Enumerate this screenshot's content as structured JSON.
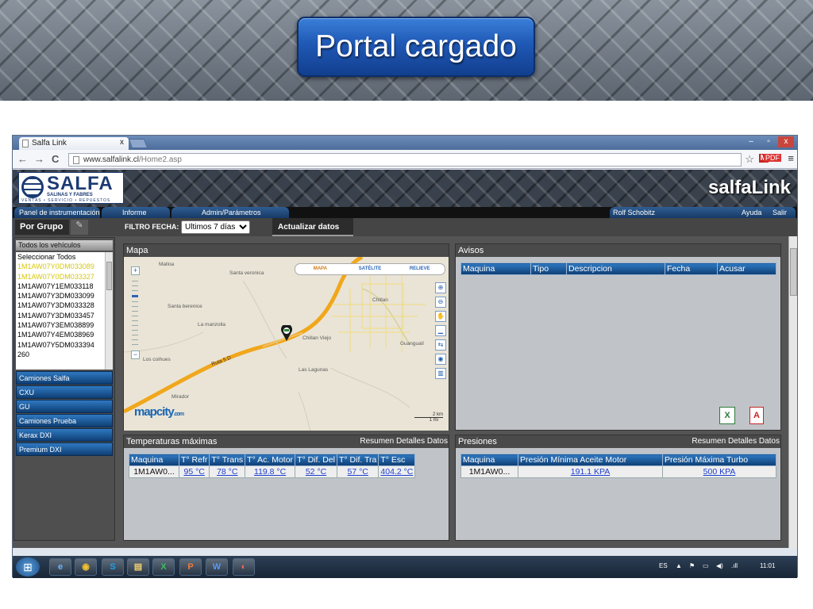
{
  "slide": {
    "title": "Portal cargado"
  },
  "browser": {
    "tab_title": "Salfa Link",
    "tab_close": "x",
    "url_host": "www.salfalink.cl",
    "url_path": "/Home2.asp",
    "win_min": "–",
    "win_max": "▫",
    "win_close": "x",
    "back_icon": "←",
    "forward_icon": "→",
    "reload_icon": "C",
    "star_icon": "☆",
    "menu_icon": "≡",
    "ext_gmail": "M",
    "ext_pdf": "PDF"
  },
  "app": {
    "logo_name": "SALFA",
    "logo_sub": "SALINAS Y FABRES",
    "logo_tag": "VENTAS • SERVICIO • REPUESTOS",
    "brand": "salfaLink",
    "nav_tabs": [
      "Panel de instrumentación",
      "Informe",
      "Admin/Parámetros"
    ],
    "user": "Rolf Schobitz",
    "help": "Ayuda",
    "logout": "Salir"
  },
  "toolbar": {
    "group_label": "Por Grupo",
    "pin_icon": "✎",
    "filter_label": "FILTRO FECHA:",
    "filter_value": "Ultimos 7 días",
    "update_label": "Actualizar datos"
  },
  "sidebar": {
    "header": "Todos los vehículos",
    "vehicles": [
      "Seleccionar Todos",
      "1M1AW07Y0DM033089",
      "1M1AW07Y0DM033327",
      "1M1AW07Y1EM033118",
      "1M1AW07Y3DM033099",
      "1M1AW07Y3DM033328",
      "1M1AW07Y3DM033457",
      "1M1AW07Y3EM038899",
      "1M1AW07Y4EM038969",
      "1M1AW07Y5DM033394",
      "260"
    ],
    "groups": [
      "Camiones Salfa",
      "CXU",
      "GU",
      "Camiones Prueba",
      "Kerax DXI",
      "Premium DXI"
    ]
  },
  "map": {
    "title": "Mapa",
    "tabs": [
      "MAPA",
      "SATÉLITE",
      "RELIEVE"
    ],
    "zoom_in": "+",
    "zoom_out": "−",
    "labels": [
      "Malloa",
      "Santa veronica",
      "Chillan",
      "Santa berenice",
      "La manzolla",
      "Chillan Viejo",
      "Guangualí",
      "Los coihues",
      "Las Lagunas",
      "Ruta 5 D",
      "Mirador"
    ],
    "provider": "mapcity",
    "provider_suffix": ".com",
    "scale_km": "2 km",
    "scale_mi": "1 mi",
    "tool_icons": [
      "zoom-in-tool-icon",
      "zoom-out-tool-icon",
      "pan-tool-icon",
      "measure-tool-icon",
      "route-tool-icon",
      "info-tool-icon",
      "chart-tool-icon"
    ]
  },
  "alerts": {
    "title": "Avisos",
    "columns": [
      "Maquina",
      "Tipo",
      "Descripcion",
      "Fecha",
      "Acusar"
    ],
    "excel_icon": "X",
    "pdf_icon": "A"
  },
  "temps": {
    "title": "Temperaturas máximas",
    "links": [
      "Resumen",
      "Detalles",
      "Datos"
    ],
    "columns": [
      "Maquina",
      "T° Refr",
      "T° Trans",
      "T° Ac. Motor",
      "T° Dif. Del",
      "T° Dif. Tra",
      "T° Esc"
    ],
    "rows": [
      [
        "1M1AW0...",
        "95 °C",
        "78 °C",
        "119.8 °C",
        "52 °C",
        "57 °C",
        "404.2 °C"
      ]
    ]
  },
  "pressures": {
    "title": "Presiones",
    "links": [
      "Resumen",
      "Detalles",
      "Datos"
    ],
    "columns": [
      "Maquina",
      "Presión Mínima Aceite Motor",
      "Presión Máxima Turbo"
    ],
    "rows": [
      [
        "1M1AW0...",
        "191.1 KPA",
        "500 KPA"
      ]
    ]
  },
  "taskbar": {
    "start_icon": "⊞",
    "apps": [
      "e",
      "◉",
      "S",
      "▤",
      "X",
      "P",
      "W",
      "◐"
    ],
    "lang": "ES",
    "tray": [
      "▲",
      "⚑",
      "▭",
      "◀)",
      ".ıll"
    ],
    "time": "11:01"
  }
}
